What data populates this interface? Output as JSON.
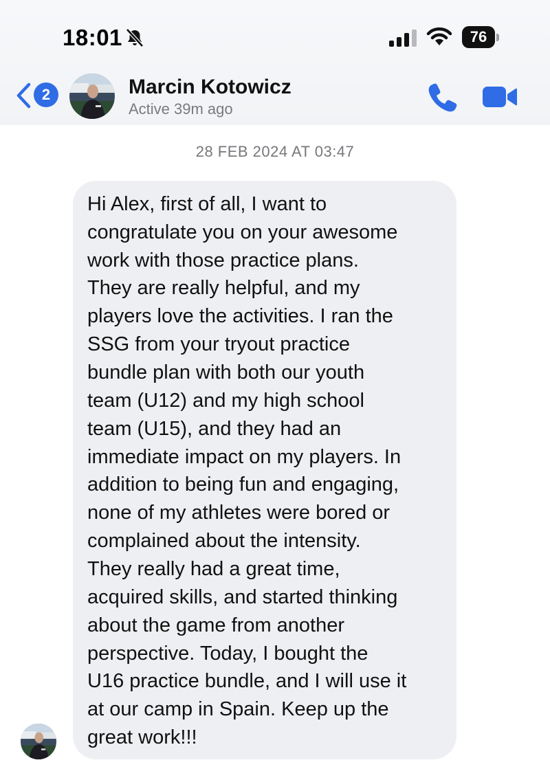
{
  "status_bar": {
    "time": "18:01",
    "battery_level": "76",
    "icons": [
      "bell-slash-icon",
      "cellular-signal-icon",
      "wifi-icon",
      "battery-icon"
    ]
  },
  "header": {
    "back_badge_count": "2",
    "contact_name": "Marcin Kotowicz",
    "contact_status": "Active 39m ago",
    "icons": [
      "chevron-left-icon",
      "phone-icon",
      "video-camera-icon"
    ],
    "accent_color": "#2f6ce5"
  },
  "conversation": {
    "timestamp": "28 FEB 2024 AT 03:47",
    "message_lines": [
      "Hi Alex, first of all, I want to",
      "congratulate you on your awesome",
      "work with those practice plans.",
      "They are really helpful, and my",
      "players love the activities. I ran the",
      "SSG from your tryout practice",
      "bundle plan with both our youth",
      "team (U12) and my high school",
      "team (U15), and they had an",
      "immediate impact on my players. In",
      "addition to being fun and engaging,",
      "none of my athletes were bored or",
      "complained about the intensity.",
      "They really had a great time,",
      "acquired skills, and started thinking",
      "about the game from another",
      "perspective. Today, I bought the",
      "U16 practice bundle, and I will use it",
      "at our camp in Spain. Keep up the",
      "great work!!!"
    ],
    "bubble_color": "#eeeff2"
  }
}
